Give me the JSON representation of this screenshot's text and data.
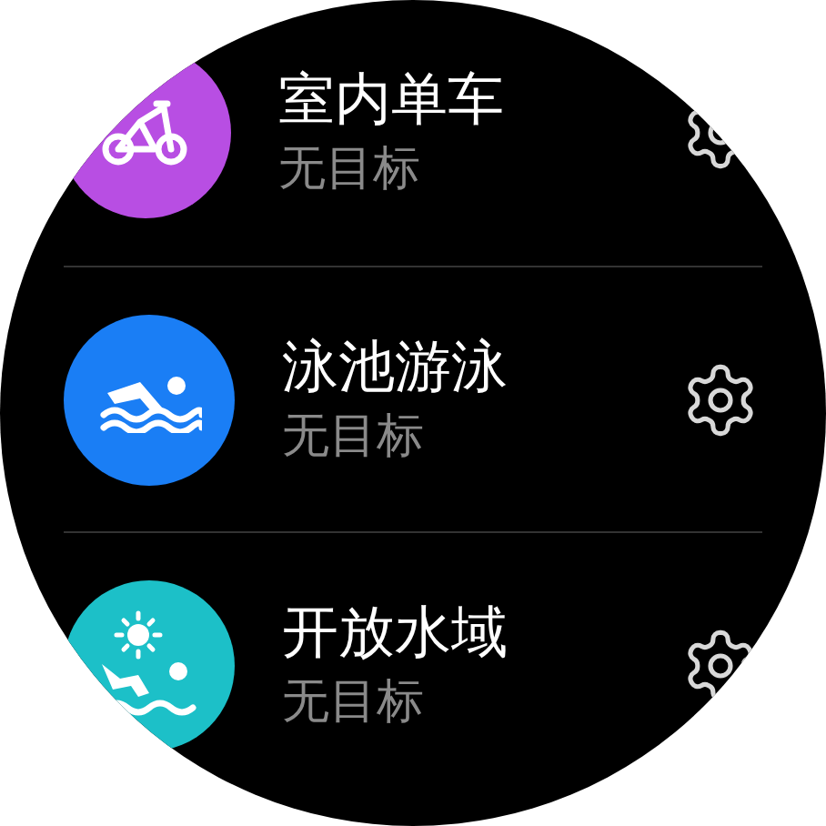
{
  "activities": [
    {
      "kind": "bike",
      "title": "室内单车",
      "subtitle": "无目标",
      "color": "#b84ee3"
    },
    {
      "kind": "swim",
      "title": "泳池游泳",
      "subtitle": "无目标",
      "color": "#1a7ef5"
    },
    {
      "kind": "openwater",
      "title": "开放水域",
      "subtitle": "无目标",
      "color": "#1cc0c8"
    }
  ]
}
